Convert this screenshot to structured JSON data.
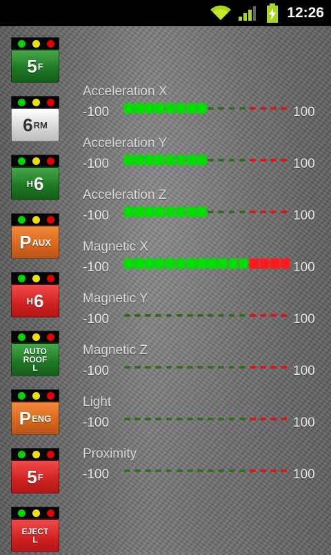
{
  "status_bar": {
    "time": "12:26",
    "icons": [
      "wifi-icon",
      "signal-icon",
      "battery-charging-icon"
    ]
  },
  "colors": {
    "green_on": "#00e000",
    "green_off": "#2f6f1e",
    "red_on": "#ff1a1a",
    "red_off": "#d81818",
    "light_green": "#00d400",
    "light_yellow": "#f0e000",
    "light_red": "#e00000"
  },
  "tiles": [
    {
      "big": "5",
      "small": "F",
      "style": "green"
    },
    {
      "big": "6",
      "small": "RM",
      "style": "white"
    },
    {
      "small": "H",
      "big": "6",
      "style": "green",
      "small_first": true
    },
    {
      "big": "P",
      "small": "AUX",
      "style": "orange"
    },
    {
      "small": "H",
      "big": "6",
      "style": "red",
      "small_first": true
    },
    {
      "lines": [
        "AUTO",
        "ROOF",
        "L"
      ],
      "style": "green"
    },
    {
      "big": "P",
      "small": "ENG",
      "style": "orange"
    },
    {
      "big": "5",
      "small": "F",
      "style": "red"
    },
    {
      "lines": [
        "EJECT",
        "L"
      ],
      "style": "red"
    }
  ],
  "sensors": [
    {
      "label": "Acceleration X",
      "min": "-100",
      "max": "100",
      "level": 0.5
    },
    {
      "label": "Acceleration Y",
      "min": "-100",
      "max": "100",
      "level": 0.5
    },
    {
      "label": "Acceleration Z",
      "min": "-100",
      "max": "100",
      "level": 0.5
    },
    {
      "label": "Magnetic X",
      "min": "-100",
      "max": "100",
      "level": 1.0
    },
    {
      "label": "Magnetic Y",
      "min": "-100",
      "max": "100",
      "level": 0.0
    },
    {
      "label": "Magnetic Z",
      "min": "-100",
      "max": "100",
      "level": 0.0
    },
    {
      "label": "Light",
      "min": "-100",
      "max": "100",
      "level": 0.0
    },
    {
      "label": "Proximity",
      "min": "-100",
      "max": "100",
      "level": 0.0
    }
  ]
}
